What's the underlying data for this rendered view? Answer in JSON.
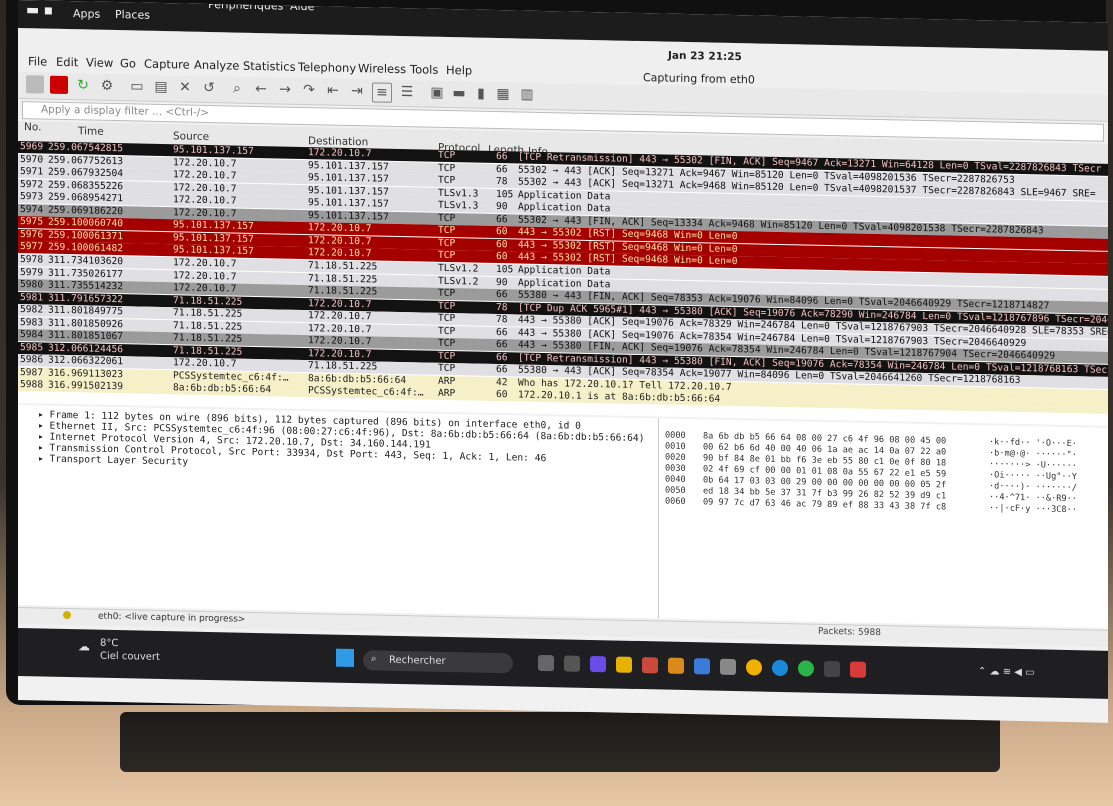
{
  "gnome_bar": {
    "apps": "Apps",
    "places": "Places",
    "clock": "Jan 23  21:25",
    "title_fragment": "Périphériques",
    "help_fragment": "Aide"
  },
  "window": {
    "title": "Capturing from eth0"
  },
  "menu": [
    "File",
    "Edit",
    "View",
    "Go",
    "Capture",
    "Analyze",
    "Statistics",
    "Telephony",
    "Wireless",
    "Tools",
    "Help"
  ],
  "filter": {
    "placeholder": "Apply a display filter ... <Ctrl-/>"
  },
  "columns": {
    "no": "No.",
    "time": "Time",
    "source": "Source",
    "destination": "Destination",
    "protocol": "Protocol",
    "length": "Length",
    "info": "Info"
  },
  "packets": [
    {
      "no": "5969",
      "time": "259.067542815",
      "src": "95.101.137.157",
      "dst": "172.20.10.7",
      "proto": "TCP",
      "len": "66",
      "info": "[TCP Retransmission] 443 → 55302 [FIN, ACK] Seq=9467 Ack=13271 Win=64128 Len=0 TSval=2287826843 TSecr",
      "style": "dark"
    },
    {
      "no": "5970",
      "time": "259.067752613",
      "src": "172.20.10.7",
      "dst": "95.101.137.157",
      "proto": "TCP",
      "len": "66",
      "info": "55302 → 443 [ACK] Seq=13271 Ack=9467 Win=85120 Len=0 TSval=4098201536 TSecr=2287826753",
      "style": "lgrey"
    },
    {
      "no": "5971",
      "time": "259.067932504",
      "src": "172.20.10.7",
      "dst": "95.101.137.157",
      "proto": "TCP",
      "len": "78",
      "info": "55302 → 443 [ACK] Seq=13271 Ack=9468 Win=85120 Len=0 TSval=4098201537 TSecr=2287826843 SLE=9467 SRE=",
      "style": "lgrey"
    },
    {
      "no": "5972",
      "time": "259.068355226",
      "src": "172.20.10.7",
      "dst": "95.101.137.157",
      "proto": "TLSv1.3",
      "len": "105",
      "info": "Application Data",
      "style": "lgrey"
    },
    {
      "no": "5973",
      "time": "259.068954271",
      "src": "172.20.10.7",
      "dst": "95.101.137.157",
      "proto": "TLSv1.3",
      "len": "90",
      "info": "Application Data",
      "style": "lgrey"
    },
    {
      "no": "5974",
      "time": "259.069186220",
      "src": "172.20.10.7",
      "dst": "95.101.137.157",
      "proto": "TCP",
      "len": "66",
      "info": "55302 → 443 [FIN, ACK] Seq=13334 Ack=9468 Win=85120 Len=0 TSval=4098201538 TSecr=2287826843",
      "style": "grey"
    },
    {
      "no": "5975",
      "time": "259.100060740",
      "src": "95.101.137.157",
      "dst": "172.20.10.7",
      "proto": "TCP",
      "len": "60",
      "info": "443 → 55302 [RST] Seq=9468 Win=0 Len=0",
      "style": "red"
    },
    {
      "no": "5976",
      "time": "259.100061371",
      "src": "95.101.137.157",
      "dst": "172.20.10.7",
      "proto": "TCP",
      "len": "60",
      "info": "443 → 55302 [RST] Seq=9468 Win=0 Len=0",
      "style": "red"
    },
    {
      "no": "5977",
      "time": "259.100061482",
      "src": "95.101.137.157",
      "dst": "172.20.10.7",
      "proto": "TCP",
      "len": "60",
      "info": "443 → 55302 [RST] Seq=9468 Win=0 Len=0",
      "style": "red"
    },
    {
      "no": "5978",
      "time": "311.734103620",
      "src": "172.20.10.7",
      "dst": "71.18.51.225",
      "proto": "TLSv1.2",
      "len": "105",
      "info": "Application Data",
      "style": "lgrey"
    },
    {
      "no": "5979",
      "time": "311.735026177",
      "src": "172.20.10.7",
      "dst": "71.18.51.225",
      "proto": "TLSv1.2",
      "len": "90",
      "info": "Application Data",
      "style": "lgrey"
    },
    {
      "no": "5980",
      "time": "311.735514232",
      "src": "172.20.10.7",
      "dst": "71.18.51.225",
      "proto": "TCP",
      "len": "66",
      "info": "55380 → 443 [FIN, ACK] Seq=78353 Ack=19076 Win=84096 Len=0 TSval=2046640929 TSecr=1218714827",
      "style": "grey"
    },
    {
      "no": "5981",
      "time": "311.791657322",
      "src": "71.18.51.225",
      "dst": "172.20.10.7",
      "proto": "TCP",
      "len": "78",
      "info": "[TCP Dup ACK 5965#1] 443 → 55380 [ACK] Seq=19076 Ack=78290 Win=246784 Len=0 TSval=1218767896 TSecr=2046",
      "style": "dark"
    },
    {
      "no": "5982",
      "time": "311.801849775",
      "src": "71.18.51.225",
      "dst": "172.20.10.7",
      "proto": "TCP",
      "len": "78",
      "info": "443 → 55380 [ACK] Seq=19076 Ack=78329 Win=246784 Len=0 TSval=1218767903 TSecr=2046640928 SLE=78353 SRE=78",
      "style": "lgrey"
    },
    {
      "no": "5983",
      "time": "311.801850926",
      "src": "71.18.51.225",
      "dst": "172.20.10.7",
      "proto": "TCP",
      "len": "66",
      "info": "443 → 55380 [ACK] Seq=19076 Ack=78354 Win=246784 Len=0 TSval=1218767903 TSecr=2046640929",
      "style": "lgrey"
    },
    {
      "no": "5984",
      "time": "311.801851067",
      "src": "71.18.51.225",
      "dst": "172.20.10.7",
      "proto": "TCP",
      "len": "66",
      "info": "443 → 55380 [FIN, ACK] Seq=19076 Ack=78354 Win=246784 Len=0 TSval=1218767904 TSecr=2046640929",
      "style": "grey"
    },
    {
      "no": "5985",
      "time": "312.066124456",
      "src": "71.18.51.225",
      "dst": "172.20.10.7",
      "proto": "TCP",
      "len": "66",
      "info": "[TCP Retransmission] 443 → 55380 [FIN, ACK] Seq=19076 Ack=78354 Win=246784 Len=0 TSval=1218768163 TSecr=204",
      "style": "dark"
    },
    {
      "no": "5986",
      "time": "312.066322061",
      "src": "172.20.10.7",
      "dst": "71.18.51.225",
      "proto": "TCP",
      "len": "66",
      "info": "55380 → 443 [ACK] Seq=78354 Ack=19077 Win=84096 Len=0 TSval=2046641260 TSecr=1218768163",
      "style": "lgrey"
    },
    {
      "no": "5987",
      "time": "316.969113023",
      "src": "PCSSystemtec_c6:4f:…",
      "dst": "8a:6b:db:b5:66:64",
      "proto": "ARP",
      "len": "42",
      "info": "Who has 172.20.10.1? Tell 172.20.10.7",
      "style": "cream"
    },
    {
      "no": "5988",
      "time": "316.991502139",
      "src": "8a:6b:db:b5:66:64",
      "dst": "PCSSystemtec_c6:4f:…",
      "proto": "ARP",
      "len": "60",
      "info": "172.20.10.1 is at 8a:6b:db:b5:66:64",
      "style": "cream"
    }
  ],
  "details": [
    "Frame 1: 112 bytes on wire (896 bits), 112 bytes captured (896 bits) on interface eth0, id 0",
    "Ethernet II, Src: PCSSystemtec_c6:4f:96 (08:00:27:c6:4f:96), Dst: 8a:6b:db:b5:66:64 (8a:6b:db:b5:66:64)",
    "Internet Protocol Version 4, Src: 172.20.10.7, Dst: 34.160.144.191",
    "Transmission Control Protocol, Src Port: 33934, Dst Port: 443, Seq: 1, Ack: 1, Len: 46",
    "Transport Layer Security"
  ],
  "hex": [
    {
      "off": "0000",
      "bytes": "8a 6b db b5 66 64 08 00  27 c6 4f 96 08 00 45 00",
      "ascii": "·k··fd·· '·O···E·"
    },
    {
      "off": "0010",
      "bytes": "00 62 b6 6d 40 00 40 06  1a ae ac 14 0a 07 22 a0",
      "ascii": "·b·m@·@· ······\"·"
    },
    {
      "off": "0020",
      "bytes": "90 bf 84 8e 01 bb f6 3e  eb 55 80 c1 0e 0f 80 18",
      "ascii": "·······> ·U······"
    },
    {
      "off": "0030",
      "bytes": "02 4f 69 cf 00 00 01 01  08 0a 55 67 22 e1 e5 59",
      "ascii": "·Oi····· ··Ug\"··Y"
    },
    {
      "off": "0040",
      "bytes": "0b 64 17 03 03 00 29 00  00 00 00 00 00 00 05 2f",
      "ascii": "·d····)· ·······/"
    },
    {
      "off": "0050",
      "bytes": "ed 18 34 bb 5e 37 31 7f  b3 99 26 82 52 39 d9 c1",
      "ascii": "··4·^71· ··&·R9··"
    },
    {
      "off": "0060",
      "bytes": "09 97 7c d7 63 46 ac 79  89 ef 88 33 43 38 7f c8",
      "ascii": "··|·cF·y ···3C8··"
    }
  ],
  "status": {
    "left": "eth0: <live capture in progress>",
    "packets": "Packets: 5988"
  },
  "taskbar": {
    "temp": "8°C",
    "weather": "Ciel couvert",
    "search": "Rechercher"
  }
}
